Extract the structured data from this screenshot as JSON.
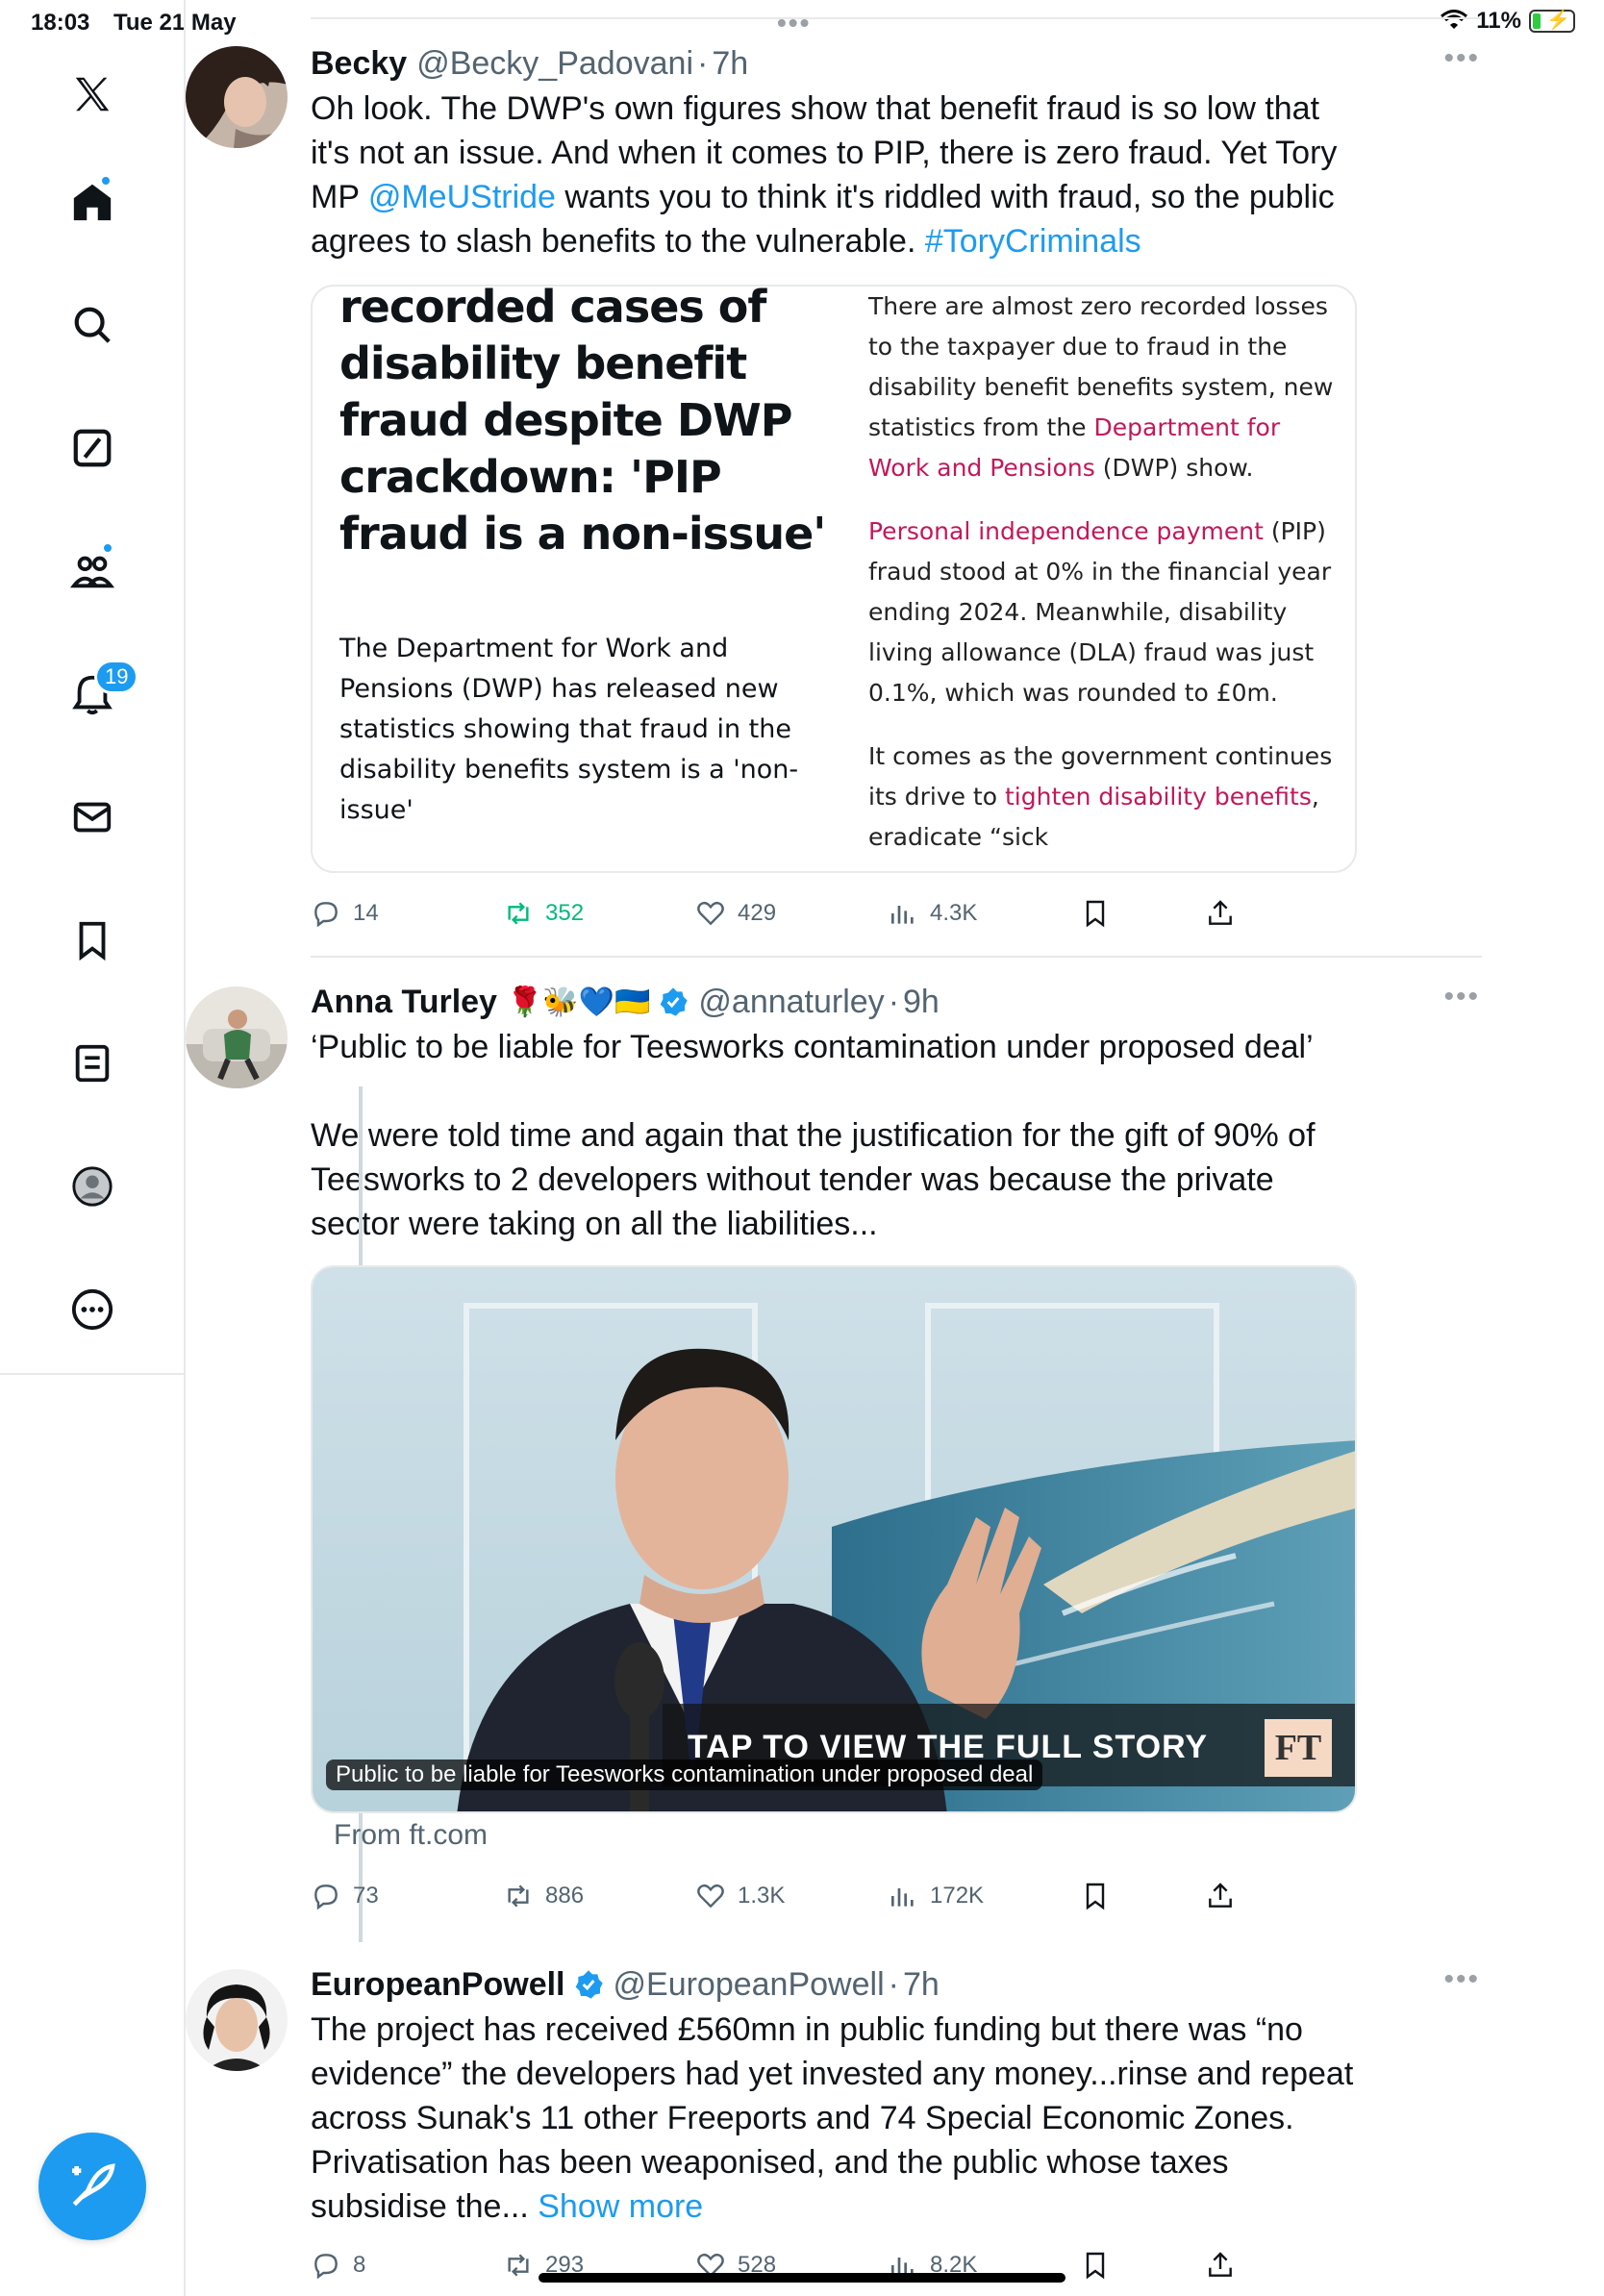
{
  "status_bar": {
    "time": "18:03",
    "date": "Tue 21 May",
    "battery": "11%"
  },
  "sidebar": {
    "notifications_count": "19",
    "accent_color": "#1d9bf0",
    "items": [
      {
        "icon": "x-logo-icon"
      },
      {
        "icon": "home-icon"
      },
      {
        "icon": "search-icon"
      },
      {
        "icon": "grok-icon"
      },
      {
        "icon": "communities-icon"
      },
      {
        "icon": "notifications-icon"
      },
      {
        "icon": "messages-icon"
      },
      {
        "icon": "bookmarks-icon"
      },
      {
        "icon": "lists-icon"
      },
      {
        "icon": "profile-icon"
      },
      {
        "icon": "more-icon"
      }
    ]
  },
  "tweets": [
    {
      "author": "Becky",
      "handle": "@Becky_Padovani",
      "time": "7h",
      "text_a": "Oh look. The DWP's own figures show that benefit fraud is so low that it's not an issue. And when it comes to PIP, there is zero fraud. Yet Tory MP ",
      "mention": "@MeUStride",
      "text_b": " wants you to think it's riddled with fraud, so the public agrees to slash benefits to the vulnerable. ",
      "hashtag": "#ToryCriminals",
      "article": {
        "headline": "recorded cases of disability benefit fraud despite DWP crackdown: 'PIP fraud is a non-issue'",
        "standfirst": "The Department for Work and Pensions (DWP) has released new statistics showing that fraud in the disability benefits system is a 'non-issue'",
        "p1_a": "There are almost zero recorded losses to the taxpayer due to fraud in the disability benefit benefits system, new statistics from the ",
        "p1_link": "Department for Work and Pensions",
        "p1_b": " (DWP) show.",
        "p2_link": "Personal independence payment",
        "p2_b": " (PIP) fraud stood at 0% in the financial year ending 2024. Meanwhile, disability living allowance (DLA) fraud was just 0.1%, which was rounded to £0m.",
        "p3_a": "It comes as the government continues its drive to ",
        "p3_link": "tighten disability benefits",
        "p3_b": ", eradicate “sick"
      },
      "stats": {
        "replies": "14",
        "reposts": "352",
        "likes": "429",
        "views": "4.3K"
      }
    },
    {
      "author": "Anna Turley",
      "emojis": "🌹🐝💙🇺🇦",
      "handle": "@annaturley",
      "time": "9h",
      "text_1": "‘Public to be liable for Teesworks contamination under proposed deal’",
      "text_2": "We were told time and again that the justification for the gift of 90% of Teesworks to 2 developers without tender was because the private sector were taking on all the liabilities...",
      "media_banner": "TAP TO VIEW THE FULL STORY",
      "media_logo": "FT",
      "media_caption": "Public to be liable for Teesworks contamination under proposed deal",
      "from": "From ft.com",
      "stats": {
        "replies": "73",
        "reposts": "886",
        "likes": "1.3K",
        "views": "172K"
      }
    },
    {
      "author": "EuropeanPowell",
      "handle": "@EuropeanPowell",
      "time": "7h",
      "text": "The project has received £560mn in public funding but there was “no evidence” the developers had yet invested any money...rinse and repeat across Sunak's 11 other Freeports and 74 Special Economic Zones. Privatisation has been weaponised, and the public whose taxes subsidise the... ",
      "show_more": "Show more",
      "stats": {
        "replies": "8",
        "reposts": "293",
        "likes": "528",
        "views": "8.2K"
      }
    }
  ],
  "repost_color": "#00ba7c"
}
